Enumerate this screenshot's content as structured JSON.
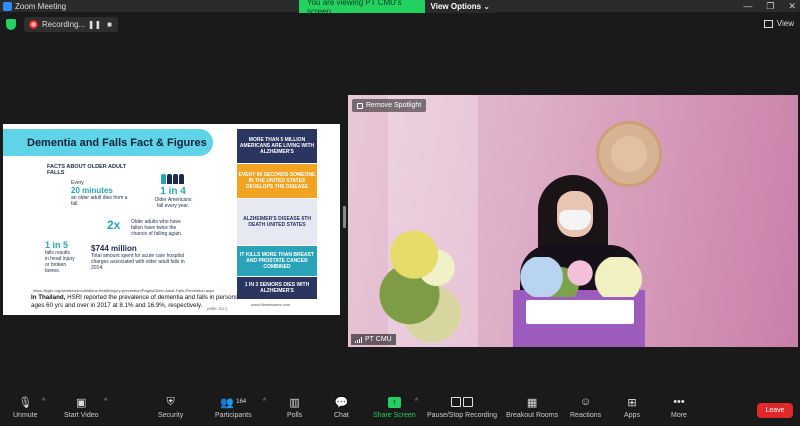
{
  "window": {
    "title": "Zoom Meeting",
    "controls": [
      "—",
      "❐",
      "✕"
    ]
  },
  "topbar": {
    "recording_label": "Recording...",
    "viewing_banner": "You are viewing PT CMU's screen",
    "view_options": "View Options ⌄",
    "view_label": "View"
  },
  "slide": {
    "title": "Dementia and Falls Fact & Figures",
    "facts_heading": "FACTS ABOUT OLDER ADULT FALLS",
    "every_label": "Every",
    "every_value": "20 minutes",
    "every_desc": "an older adult dies from a fall.",
    "one_in_four": "1 in 4",
    "one_in_four_desc": "Older Americans fall every year.",
    "two_x": "2x",
    "two_x_desc": "Older adults who have fallen have twice the chance of falling again.",
    "one_in_five": "1 in 5",
    "one_in_five_desc": "falls results in head injury or broken bones.",
    "cost": "$744 million",
    "cost_desc": "Total amount spent for acute care hospital charges associated with older adult falls in 2014.",
    "source": "https://bgllc.org/whatsendo/childrens-health/injury-prevention/Pages/Older-Adult-Falls-Prevention.aspx",
    "thai_bold": "In Thailand,",
    "thai_text": " HSRI reported the prevalence of dementia and falls in persons ages 60 yrs and over in 2017 at 8.1% and 16.9%, respectively.",
    "hsri_note": "(HSRI, 2017)",
    "right_cards": [
      "MORE THAN 5 MILLION AMERICANS ARE LIVING WITH ALZHEIMER'S",
      "EVERY 66 SECONDS SOMEONE IN THE UNITED STATES DEVELOPS THE DISEASE",
      "ALZHEIMER'S DISEASE 6TH DEATH UNITED STATES",
      "IT KILLS MORE THAN BREAST AND PROSTATE CANCER COMBINED",
      "1 IN 3 SENIORS DIES WITH ALZHEIMER'S"
    ],
    "url": "www.5heartcares.com"
  },
  "spotlight": {
    "remove_label": "Remove Spotlight",
    "participant_name": "PT CMU"
  },
  "toolbar": {
    "unmute": "Unmute",
    "start_video": "Start Video",
    "security": "Security",
    "participants": "Participants",
    "participants_count": "164",
    "polls": "Polls",
    "chat": "Chat",
    "share_screen": "Share Screen",
    "pause_stop": "Pause/Stop Recording",
    "breakout": "Breakout Rooms",
    "reactions": "Reactions",
    "apps": "Apps",
    "more": "More",
    "leave": "Leave"
  },
  "colors": {
    "accent_green": "#23d160",
    "leave_red": "#e02828",
    "slide_title_bg": "#5fd3e8"
  }
}
